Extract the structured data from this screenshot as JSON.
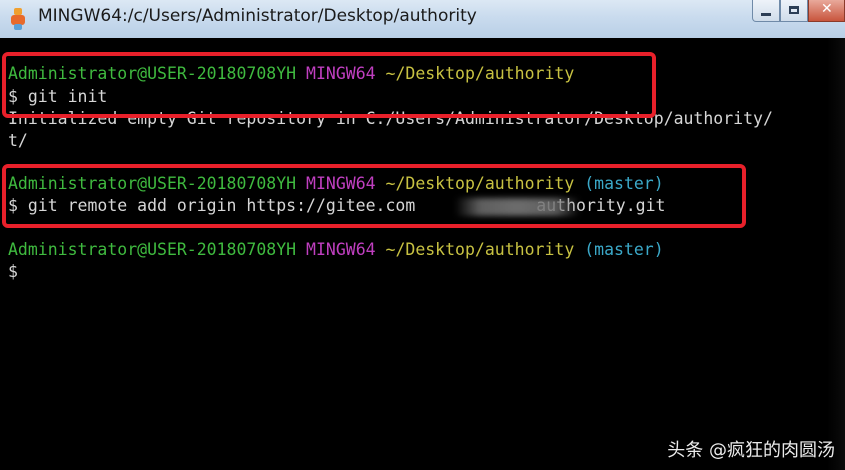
{
  "window": {
    "title": "MINGW64:/c/Users/Administrator/Desktop/authority"
  },
  "terminal": {
    "block1": {
      "user_host": "Administrator@USER-20180708YH",
      "shell": "MINGW64",
      "path": "~/Desktop/authority",
      "command": "$ git init",
      "output_line1": "Initialized empty Git repository in C:/Users/Administrator/Desktop/authority/",
      "output_line2": "t/"
    },
    "block2": {
      "user_host": "Administrator@USER-20180708YH",
      "shell": "MINGW64",
      "path": "~/Desktop/authority",
      "branch": "(master)",
      "command_part1": "$ git remote add origin https://gitee.com",
      "command_part2": "authority.git"
    },
    "block3": {
      "user_host": "Administrator@USER-20180708YH",
      "shell": "MINGW64",
      "path": "~/Desktop/authority",
      "branch": "(master)",
      "prompt": "$"
    }
  },
  "watermark": "头条 @疯狂的肉圆汤",
  "colors": {
    "user_host": "#3fba3f",
    "shell": "#c03fc0",
    "path": "#c8c242",
    "branch": "#3ba9c9",
    "highlight": "#e8202a"
  }
}
